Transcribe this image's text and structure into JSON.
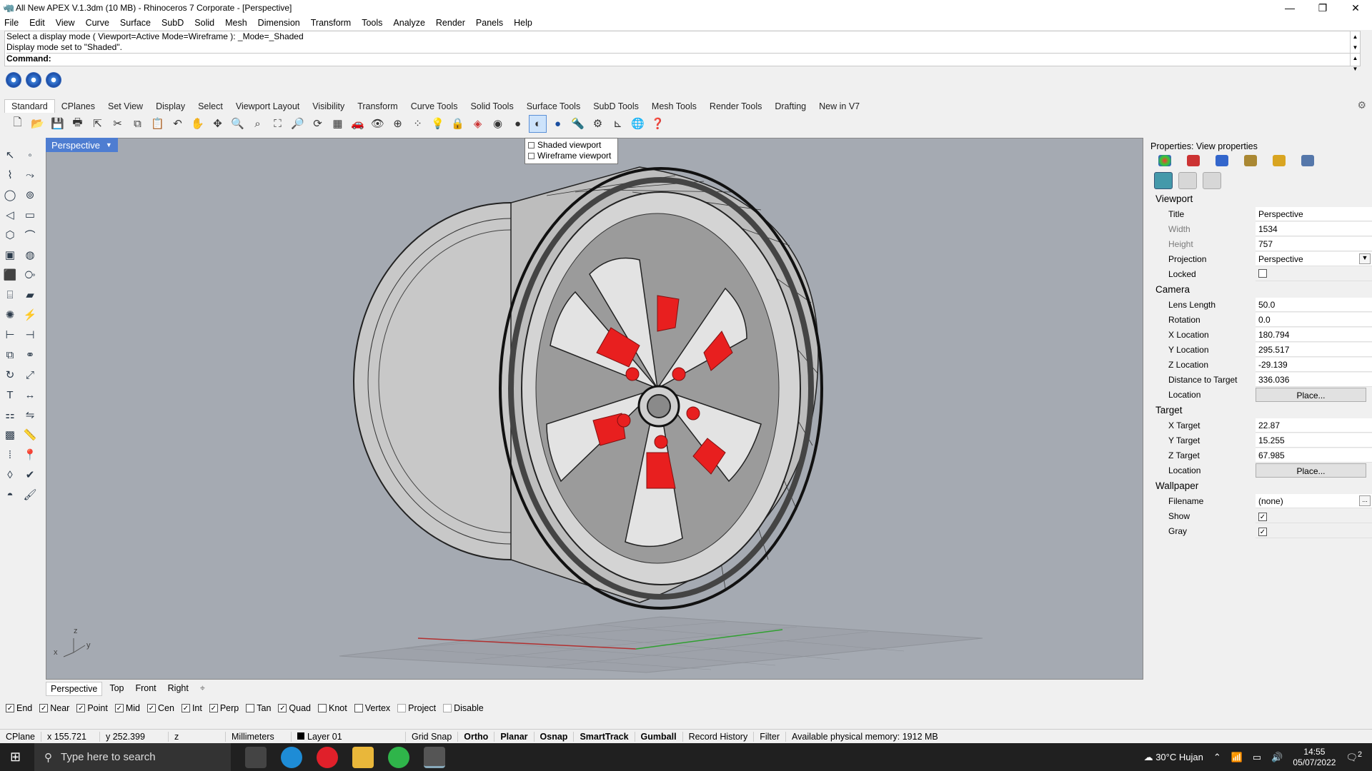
{
  "window": {
    "title": "All New APEX V.1.3dm (10 MB) - Rhinoceros 7 Corporate - [Perspective]"
  },
  "menu": [
    "File",
    "Edit",
    "View",
    "Curve",
    "Surface",
    "SubD",
    "Solid",
    "Mesh",
    "Dimension",
    "Transform",
    "Tools",
    "Analyze",
    "Render",
    "Panels",
    "Help"
  ],
  "command": {
    "history1": "Select a display mode ( Viewport=Active  Mode=Wireframe ): _Mode=_Shaded",
    "history2": "Display mode set to \"Shaded\".",
    "prompt": "Command:"
  },
  "toolbar_tabs": [
    "Standard",
    "CPlanes",
    "Set View",
    "Display",
    "Select",
    "Viewport Layout",
    "Visibility",
    "Transform",
    "Curve Tools",
    "Solid Tools",
    "Surface Tools",
    "SubD Tools",
    "Mesh Tools",
    "Render Tools",
    "Drafting",
    "New in V7"
  ],
  "viewport": {
    "name": "Perspective",
    "axis_labels": {
      "z": "z",
      "x": "x",
      "y": "y"
    }
  },
  "popup": {
    "item1": "Shaded viewport",
    "item2": "Wireframe viewport"
  },
  "viewport_tabs": [
    "Perspective",
    "Top",
    "Front",
    "Right"
  ],
  "osnaps": [
    {
      "label": "End",
      "checked": true
    },
    {
      "label": "Near",
      "checked": true
    },
    {
      "label": "Point",
      "checked": true
    },
    {
      "label": "Mid",
      "checked": true
    },
    {
      "label": "Cen",
      "checked": true
    },
    {
      "label": "Int",
      "checked": true
    },
    {
      "label": "Perp",
      "checked": true
    },
    {
      "label": "Tan",
      "checked": false
    },
    {
      "label": "Quad",
      "checked": true
    },
    {
      "label": "Knot",
      "checked": false
    },
    {
      "label": "Vertex",
      "checked": false
    },
    {
      "label": "Project",
      "checked": false,
      "disabled": true
    },
    {
      "label": "Disable",
      "checked": false,
      "disabled": true
    }
  ],
  "status": {
    "cplane": "CPlane",
    "x": "x 155.721",
    "y": "y 252.399",
    "z": "z",
    "units": "Millimeters",
    "layer": "Layer 01",
    "grid_snap": "Grid Snap",
    "ortho": "Ortho",
    "planar": "Planar",
    "osnap": "Osnap",
    "smarttrack": "SmartTrack",
    "gumball": "Gumball",
    "record_history": "Record History",
    "filter": "Filter",
    "memory": "Available physical memory: 1912 MB"
  },
  "properties": {
    "header": "Properties: View properties",
    "viewport_section": "Viewport",
    "title_label": "Title",
    "title_value": "Perspective",
    "width_label": "Width",
    "width_value": "1534",
    "height_label": "Height",
    "height_value": "757",
    "projection_label": "Projection",
    "projection_value": "Perspective",
    "locked_label": "Locked",
    "camera_section": "Camera",
    "lens_label": "Lens Length",
    "lens_value": "50.0",
    "rotation_label": "Rotation",
    "rotation_value": "0.0",
    "xloc_label": "X Location",
    "xloc_value": "180.794",
    "yloc_label": "Y Location",
    "yloc_value": "295.517",
    "zloc_label": "Z Location",
    "zloc_value": "-29.139",
    "dist_label": "Distance to Target",
    "dist_value": "336.036",
    "location_label": "Location",
    "place_label": "Place...",
    "target_section": "Target",
    "xt_label": "X Target",
    "xt_value": "22.87",
    "yt_label": "Y Target",
    "yt_value": "15.255",
    "zt_label": "Z Target",
    "zt_value": "67.985",
    "wallpaper_section": "Wallpaper",
    "filename_label": "Filename",
    "filename_value": "(none)",
    "show_label": "Show",
    "gray_label": "Gray",
    "browse_label": "..."
  },
  "taskbar": {
    "search_placeholder": "Type here to search",
    "weather": "30°C  Hujan",
    "time": "14:55",
    "date": "05/07/2022",
    "notif_count": "2"
  },
  "colors": {
    "viewport_bg": "#a5aab2",
    "accent": "#4e7dd1",
    "highlight_red": "#e81f1f"
  }
}
